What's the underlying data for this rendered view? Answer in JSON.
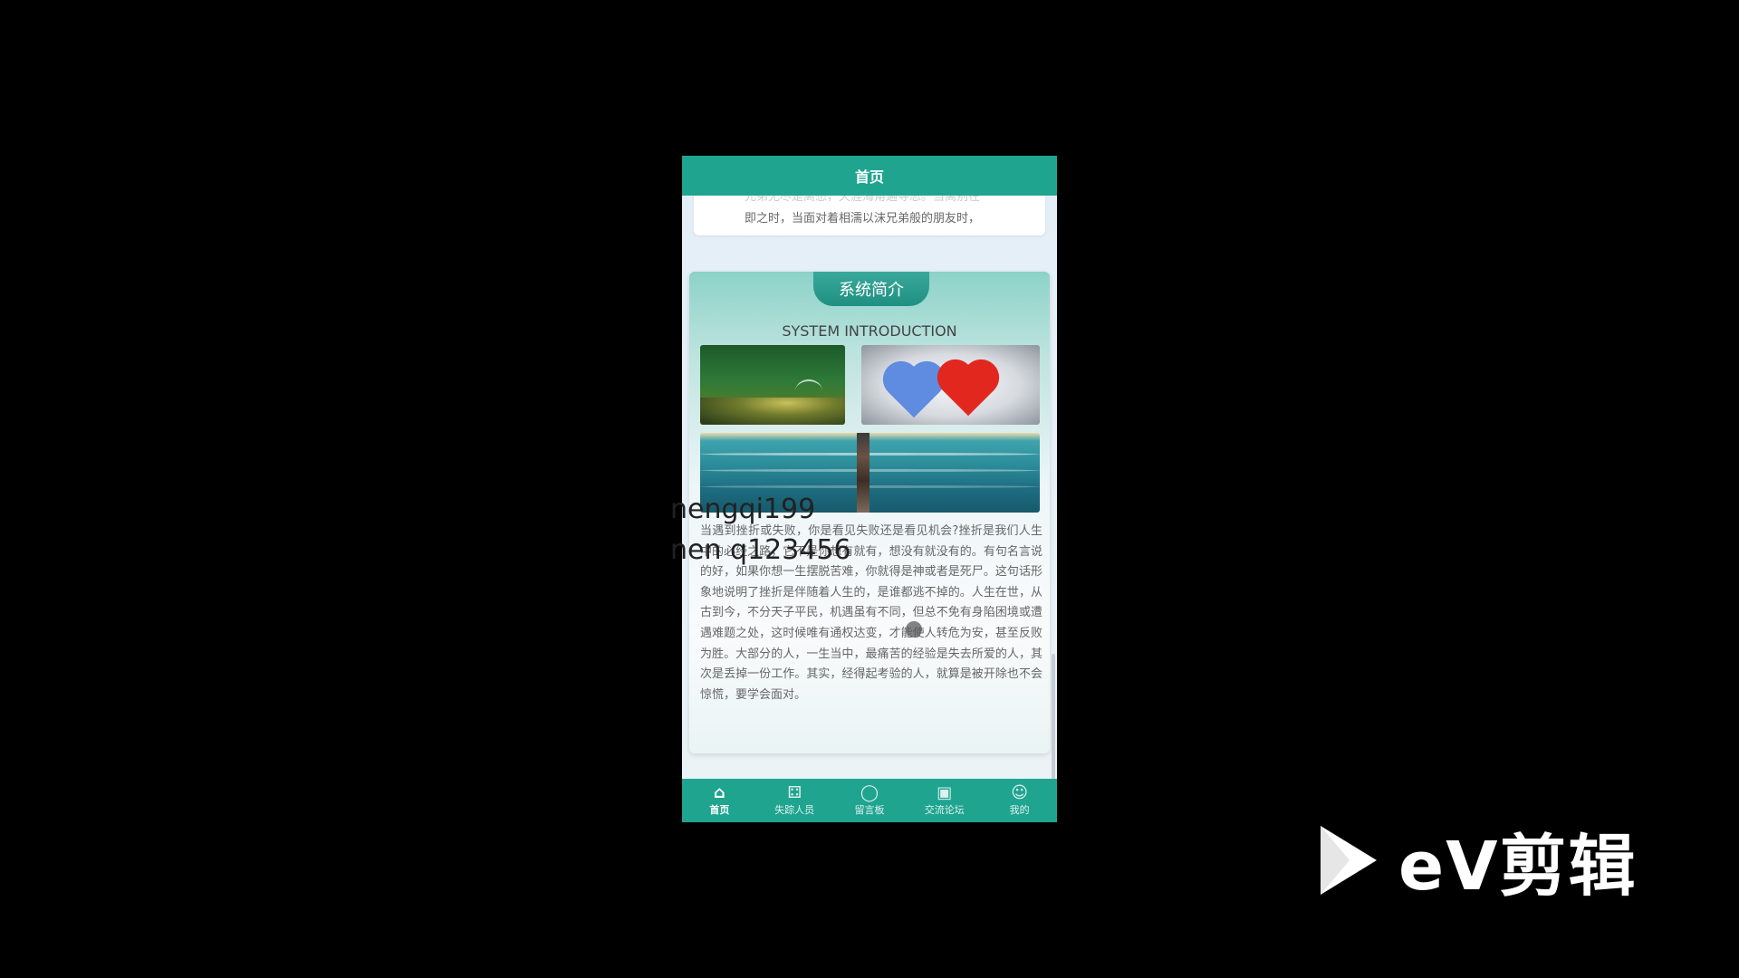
{
  "app": {
    "title": "首页"
  },
  "previous_card": {
    "text_line_cut": "兄弟无尽是离愁，天涯海角遍寻思。当离别在",
    "text_line": "即之时，当面对着相濡以沫兄弟般的朋友时，"
  },
  "intro": {
    "tab_label": "系统简介",
    "subtitle": "SYSTEM INTRODUCTION",
    "images": [
      "moss-photo",
      "hearts-photo",
      "lighthouse-sea-photo"
    ],
    "text": "当遇到挫折或失败，你是看见失败还是看见机会?挫折是我们人生中的必经之路，它不是你想有就有，想没有就没有的。有句名言说的好，如果你想一生摆脱苦难，你就得是神或者是死尸。这句话形象地说明了挫折是伴随着人生的，是谁都逃不掉的。人生在世，从古到今，不分天子平民，机遇虽有不同，但总不免有身陷困境或遭遇难题之处，这时候唯有通权达变，才能使人转危为安，甚至反败为胜。大部分的人，一生当中，最痛苦的经验是失去所爱的人，其次是丢掉一份工作。其实，经得起考验的人，就算是被开除也不会惊慌，要学会面对。"
  },
  "overlay": {
    "watermark_line1": "nengqi199",
    "watermark_line2": "nen q123456"
  },
  "bottom_nav": {
    "items": [
      {
        "label": "首页",
        "icon": "home-icon",
        "glyph": "⌂"
      },
      {
        "label": "失踪人员",
        "icon": "apps-icon",
        "glyph": "⚃"
      },
      {
        "label": "留言板",
        "icon": "chat-icon",
        "glyph": "◯"
      },
      {
        "label": "交流论坛",
        "icon": "forum-icon",
        "glyph": "▣"
      },
      {
        "label": "我的",
        "icon": "user-icon",
        "glyph": "☺"
      }
    ]
  },
  "branding": {
    "logo_text": "eV剪辑"
  },
  "colors": {
    "accent": "#1fa490",
    "background": "#000000",
    "card_gradient_top": "#8cd2c8"
  }
}
